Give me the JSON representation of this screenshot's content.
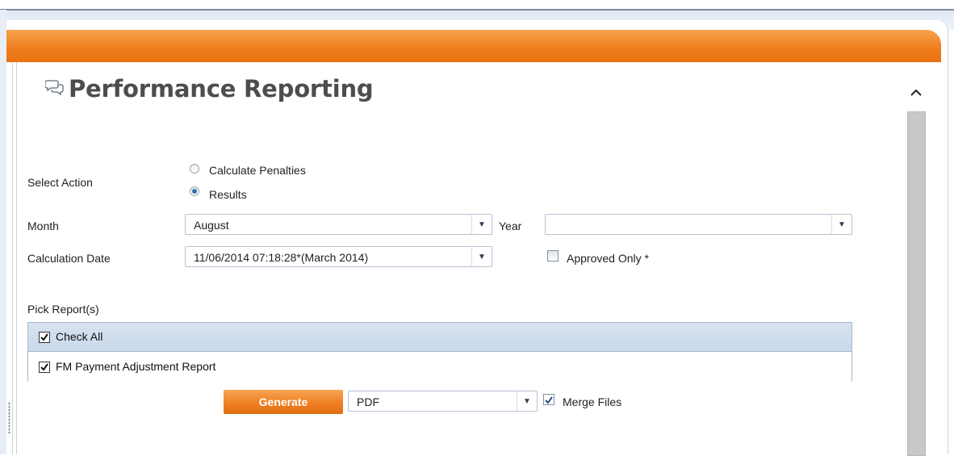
{
  "page": {
    "title": "Performance Reporting",
    "title_icon": "speech-bubbles-icon"
  },
  "form": {
    "select_action_label": "Select Action",
    "actions": [
      {
        "label": "Calculate Penalties",
        "selected": false
      },
      {
        "label": "Results",
        "selected": true
      }
    ],
    "month_label": "Month",
    "month_value": "August",
    "year_label": "Year",
    "year_value": "",
    "calc_date_label": "Calculation Date",
    "calc_date_value": "11/06/2014 07:18:28*(March 2014)",
    "approved_only_label": "Approved Only *",
    "approved_only_checked": false
  },
  "reports": {
    "label": "Pick Report(s)",
    "check_all_label": "Check All",
    "check_all_checked": true,
    "items": [
      {
        "label": "FM Payment Adjustment Report",
        "checked": true
      }
    ]
  },
  "output": {
    "generate_label": "Generate",
    "format_value": "PDF",
    "merge_label": "Merge Files",
    "merge_checked": true
  },
  "scrollbar": {
    "up_icon": "chevron-up-icon"
  },
  "colors": {
    "header_orange": "#ef7d1d",
    "list_header_blue": "#c9d8eb",
    "title_gray": "#4d4d4d"
  }
}
